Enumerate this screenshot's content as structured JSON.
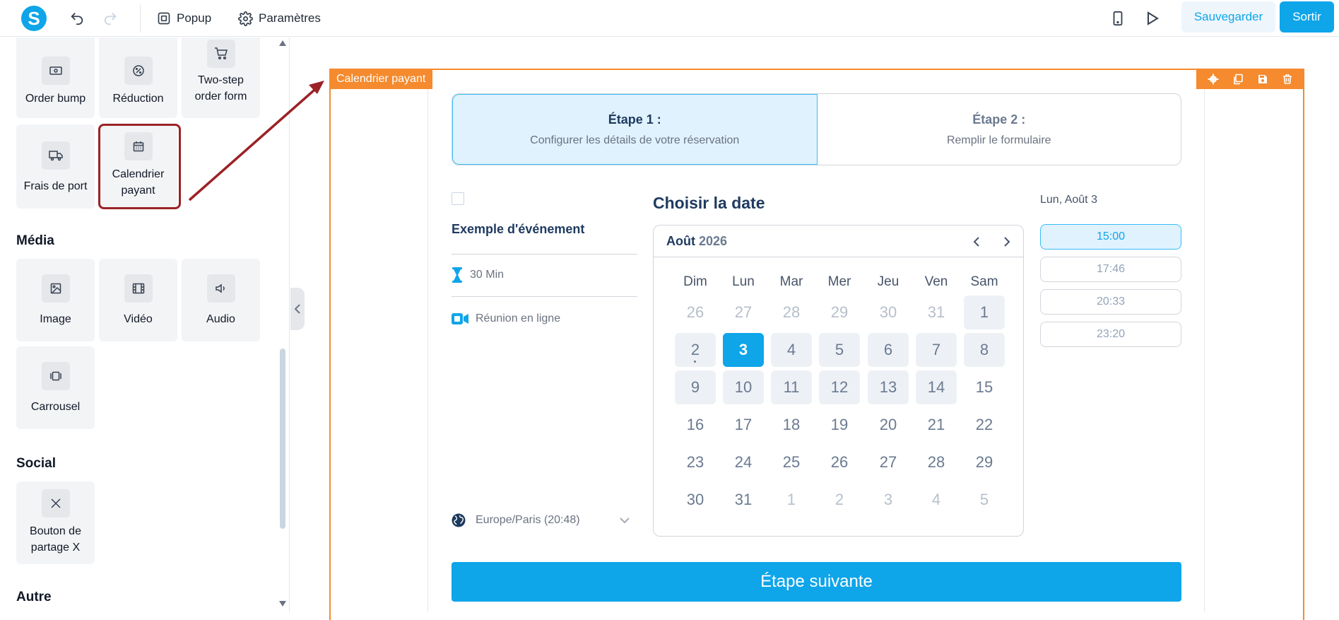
{
  "toolbar": {
    "popup_label": "Popup",
    "settings_label": "Paramètres",
    "save_label": "Sauvegarder",
    "exit_label": "Sortir",
    "logo_letter": "S"
  },
  "sidebar": {
    "elements_row1": [
      "Order bump",
      "Réduction",
      "Two-step order form"
    ],
    "elements_row2": [
      "Frais de port",
      "Calendrier payant"
    ],
    "media_title": "Média",
    "media_items": [
      "Image",
      "Vidéo",
      "Audio",
      "Carrousel"
    ],
    "social_title": "Social",
    "social_items": [
      "Bouton de partage X"
    ],
    "other_title": "Autre"
  },
  "block": {
    "tag": "Calendrier payant"
  },
  "steps": [
    {
      "title": "Étape 1 :",
      "desc": "Configurer les détails de votre réservation"
    },
    {
      "title": "Étape 2 :",
      "desc": "Remplir le formulaire"
    }
  ],
  "event": {
    "title": "Exemple d'événement",
    "duration": "30 Min",
    "location": "Réunion en ligne",
    "timezone": "Europe/Paris (20:48)"
  },
  "calendar": {
    "heading": "Choisir la date",
    "month": "Août",
    "year": "2026",
    "weekdays": [
      "Dim",
      "Lun",
      "Mar",
      "Mer",
      "Jeu",
      "Ven",
      "Sam"
    ],
    "weeks": [
      [
        "26",
        "27",
        "28",
        "29",
        "30",
        "31",
        "1"
      ],
      [
        "2",
        "3",
        "4",
        "5",
        "6",
        "7",
        "8"
      ],
      [
        "9",
        "10",
        "11",
        "12",
        "13",
        "14",
        "15"
      ],
      [
        "16",
        "17",
        "18",
        "19",
        "20",
        "21",
        "22"
      ],
      [
        "23",
        "24",
        "25",
        "26",
        "27",
        "28",
        "29"
      ],
      [
        "30",
        "31",
        "1",
        "2",
        "3",
        "4",
        "5"
      ]
    ],
    "selected_day": "3"
  },
  "slots": {
    "date_label": "Lun, Août 3",
    "times": [
      "15:00",
      "17:46",
      "20:33",
      "23:20"
    ],
    "selected": "15:00"
  },
  "next_button": "Étape suivante",
  "colors": {
    "accent": "#0ea5e9",
    "block_border": "#f58a2e",
    "annotation": "#9b2226"
  }
}
